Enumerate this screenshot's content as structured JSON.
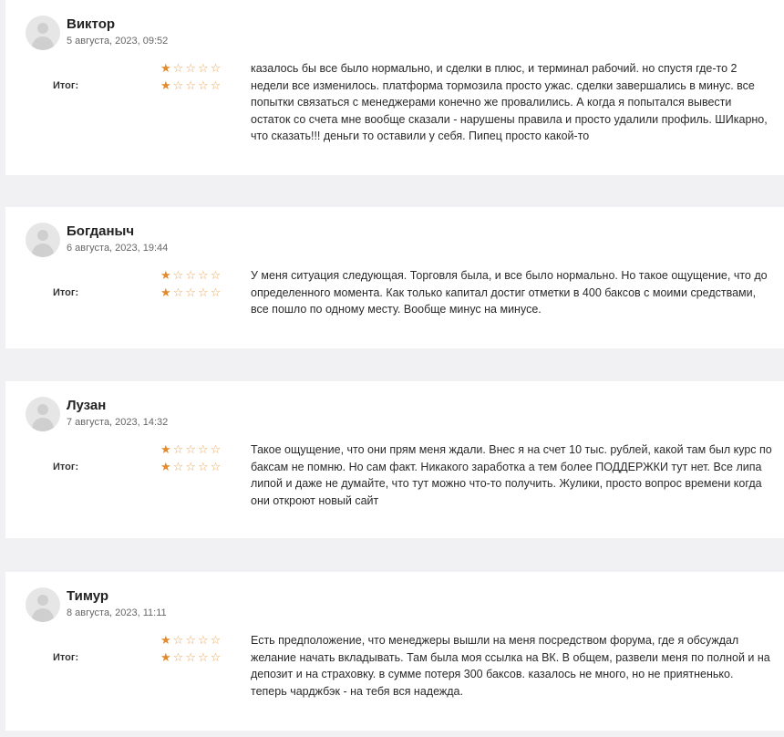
{
  "rating_label": "Итог:",
  "star_color": "#e38a2a",
  "reviews": [
    {
      "name": "Виктор",
      "date": "5 августа, 2023, 09:52",
      "rating_1": 1,
      "rating_2": 1,
      "max_rating": 5,
      "text": "казалось бы все было нормально, и сделки в плюс, и терминал рабочий. но спустя где-то 2 недели все изменилось. платформа тормозила просто ужас. сделки завершались в минус. все попытки связаться с менеджерами конечно же провалились. А когда я попытался вывести остаток со счета мне вообще сказали - нарушены правила и просто удалили профиль. ШИкарно, что сказать!!! деньги то оставили у себя. Пипец просто какой-то"
    },
    {
      "name": "Богданыч",
      "date": "6 августа, 2023, 19:44",
      "rating_1": 1,
      "rating_2": 1,
      "max_rating": 5,
      "text": "У меня ситуация следующая. Торговля была, и все было нормально. Но такое ощущение, что до определенного момента. Как только капитал достиг отметки в 400 баксов с моими средствами, все пошло по одному месту. Вообще минус на минусе."
    },
    {
      "name": "Лузан",
      "date": "7 августа, 2023, 14:32",
      "rating_1": 1,
      "rating_2": 1,
      "max_rating": 5,
      "text": "Такое ощущение, что они прям меня ждали. Внес я на счет 10 тыс. рублей, какой там был курс по баксам не помню. Но сам факт. Никакого заработка а тем более ПОДДЕРЖКИ тут нет. Все липа липой и даже не думайте, что тут можно что-то получить. Жулики, просто вопрос времени когда они откроют новый сайт"
    },
    {
      "name": "Тимур",
      "date": "8 августа, 2023, 11:11",
      "rating_1": 1,
      "rating_2": 1,
      "max_rating": 5,
      "text": "Есть предположение, что менеджеры вышли на меня посредством форума, где я обсуждал желание начать вкладывать. Там была моя ссылка на ВК. В общем, развели меня по полной и на депозит и на страховку. в сумме потеря 300 баксов. казалось не много, но не приятненько. теперь чарджбэк - на тебя вся надежда."
    }
  ]
}
